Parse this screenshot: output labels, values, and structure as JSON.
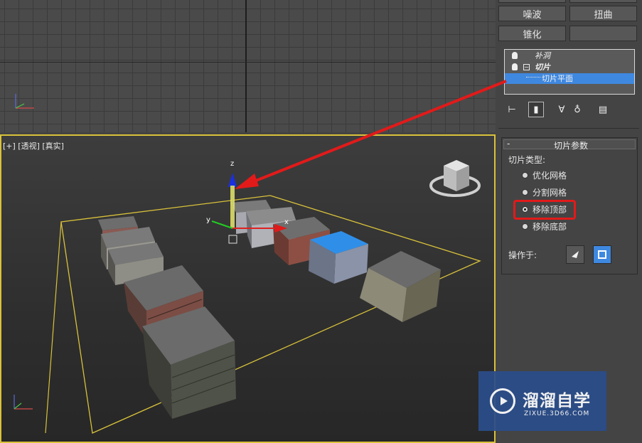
{
  "modifier_buttons": {
    "noise": "噪波",
    "twist": "扭曲",
    "taper": "锥化"
  },
  "modifier_stack": {
    "items": [
      {
        "label": "补洞"
      },
      {
        "label": "切片"
      },
      {
        "label": "切片平面"
      }
    ]
  },
  "rollout": {
    "title": "切片参数",
    "slice_type_label": "切片类型:",
    "options": [
      {
        "label": "优化网格",
        "selected": false
      },
      {
        "label": "分割网格",
        "selected": false
      },
      {
        "label": "移除顶部",
        "selected": true
      },
      {
        "label": "移除底部",
        "selected": false
      }
    ],
    "operate_on_label": "操作于:"
  },
  "viewport": {
    "label": "[+] [透视] [真实]"
  },
  "gizmo_axis": {
    "z": "z",
    "y": "y",
    "x": "x"
  },
  "watermark": {
    "title": "溜溜自学",
    "url": "ZIXUE.3D66.COM"
  },
  "colors": {
    "viewport_border": "#d9c23a",
    "selection_blue": "#3f88e0",
    "highlight_red": "#e21a1a",
    "arrow_red": "#e21a1a"
  }
}
